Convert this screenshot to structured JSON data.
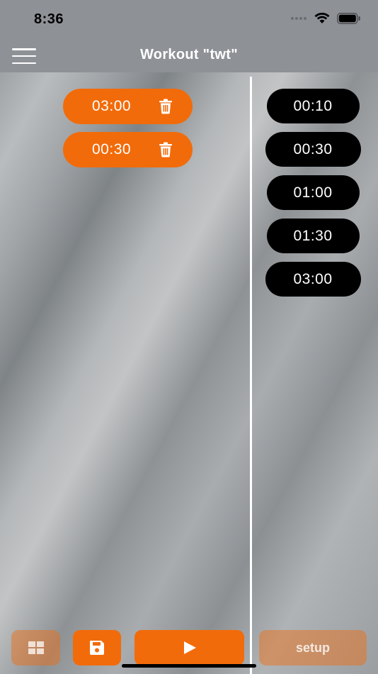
{
  "status_bar": {
    "time": "8:36"
  },
  "nav": {
    "title": "Workout \"twt\"",
    "menu_icon": "hamburger-menu-icon"
  },
  "intervals": [
    {
      "time": "03:00"
    },
    {
      "time": "00:30"
    }
  ],
  "presets": [
    {
      "time": "00:10"
    },
    {
      "time": "00:30"
    },
    {
      "time": "01:00"
    },
    {
      "time": "01:30"
    },
    {
      "time": "03:00"
    }
  ],
  "toolbar": {
    "grid_icon": "grid-icon",
    "save_icon": "save-icon",
    "play_icon": "play-icon",
    "setup_label": "setup"
  },
  "colors": {
    "accent": "#f26b0a",
    "accent_disabled": "#f26b0a73",
    "preset_bg": "#000000",
    "bar_bg": "#8e9196"
  }
}
